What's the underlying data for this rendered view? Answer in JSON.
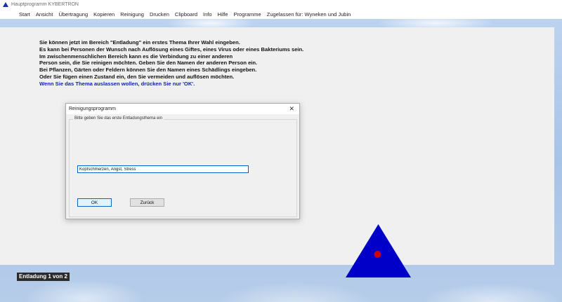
{
  "window": {
    "title": "Hauptprogramm KYBERTRON"
  },
  "menu": {
    "items": [
      "Start",
      "Ansicht",
      "Übertragung",
      "Kopieren",
      "Reinigung",
      "Drucken",
      "Clipboard",
      "Info",
      "Hilfe",
      "Programme",
      "Zugelassen für: Wyneken und Jubin"
    ]
  },
  "instructions": {
    "lines": [
      "Sie können jetzt im Bereich \"Entladung\" ein erstes Thema Ihrer Wahl eingeben.",
      "Es kann bei Personen der Wunsch nach Auflösung eines Giftes, eines Virus oder eines Bakteriums sein.",
      "Im zwischenmenschlichen Bereich kann es die Verbindung zu einer anderen",
      "Person sein, die Sie reinigen möchten. Geben Sie den Namen der anderen Person ein.",
      "Bei Pflanzen, Gärten oder Feldern können Sie den Namen eines Schädlings eingeben.",
      "Oder Sie fügen einen Zustand ein, den Sie vermeiden und auflösen möchten."
    ],
    "highlight": "Wenn Sie das Thema auslassen wollen, drücken Sie nur 'OK'."
  },
  "dialog": {
    "title": "Reinigungsprogramm",
    "close_symbol": "✕",
    "group_label": "Bitte geben Sie das erste Entladungsthema ein",
    "input_value": "Kopfschmerzen, Angst, Stress",
    "ok_label": "OK",
    "back_label": "Zurück"
  },
  "status": {
    "label": "Entladung 1 von 2"
  },
  "colors": {
    "triangle": "#0000c8",
    "dot": "#d00000",
    "highlight_text": "#0b1fb8"
  }
}
